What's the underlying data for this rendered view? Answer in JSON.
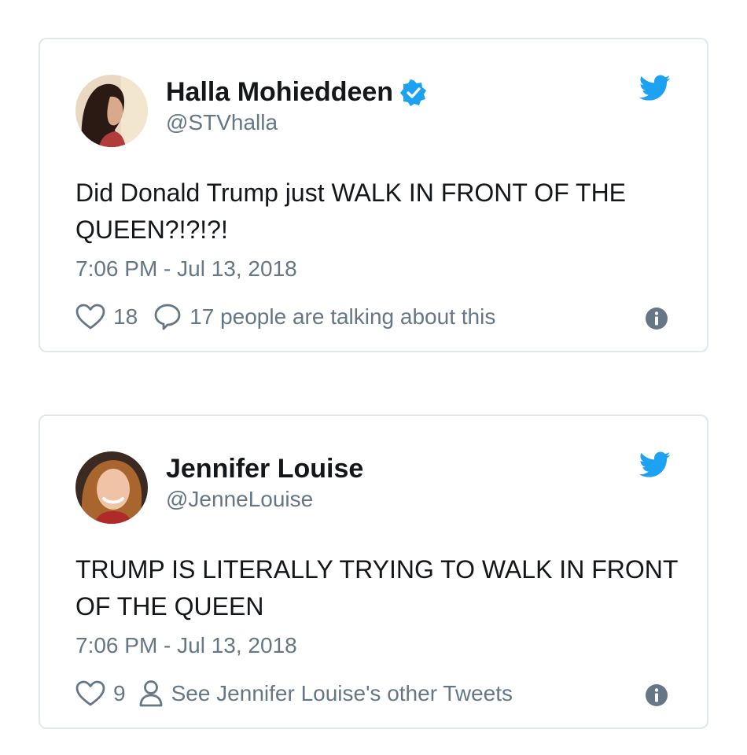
{
  "tweets": [
    {
      "name": "Halla Mohieddeen",
      "handle": "@STVhalla",
      "verified": true,
      "text": "Did Donald Trump just WALK IN FRONT OF THE QUEEN?!?!?!",
      "timestamp": "7:06 PM - Jul 13, 2018",
      "likes": "18",
      "secondary_action": "17 people are talking about this",
      "secondary_icon": "comment-icon"
    },
    {
      "name": "Jennifer Louise",
      "handle": "@JenneLouise",
      "verified": false,
      "text": "TRUMP IS LITERALLY TRYING TO WALK IN FRONT OF THE QUEEN",
      "timestamp": "7:06 PM - Jul 13, 2018",
      "likes": "9",
      "secondary_action": "See Jennifer Louise's other Tweets",
      "secondary_icon": "person-icon"
    }
  ],
  "colors": {
    "twitter_blue": "#1da1f2",
    "text": "#14171a",
    "muted": "#657786",
    "border": "#e1e8ed"
  }
}
